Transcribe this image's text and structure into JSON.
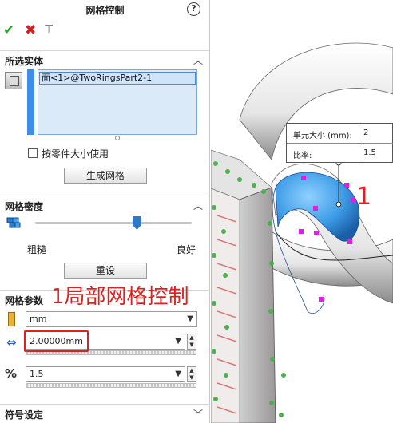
{
  "panel": {
    "title": "网格控制",
    "help_glyph": "?",
    "ok_glyph": "✔",
    "cancel_glyph": "✖",
    "pin_glyph": "⊣"
  },
  "selected_entities": {
    "heading": "所选实体",
    "items": [
      "面<1>@TwoRingsPart2-1"
    ],
    "use_part_size_label": "按零件大小使用",
    "use_part_size_checked": false,
    "create_mesh_button": "生成网格"
  },
  "mesh_density": {
    "heading": "网格密度",
    "coarse_label": "粗糙",
    "fine_label": "良好",
    "slider_fraction": 0.65,
    "reset_button": "重设"
  },
  "mesh_parameters": {
    "heading": "网格参数",
    "unit": "mm",
    "element_size": "2.00000mm",
    "ratio": "1.5"
  },
  "symbol_settings": {
    "heading": "符号设定"
  },
  "annotation": {
    "text": "1局部网格控制",
    "marker": "1"
  },
  "callout": {
    "element_size_label": "单元大小 (mm):",
    "element_size_value": "2",
    "ratio_label": "比率:",
    "ratio_value": "1.5"
  },
  "colors": {
    "accent": "#3c8ee8",
    "annotation_red": "#e02020",
    "selected_face": "#3d9be6"
  }
}
